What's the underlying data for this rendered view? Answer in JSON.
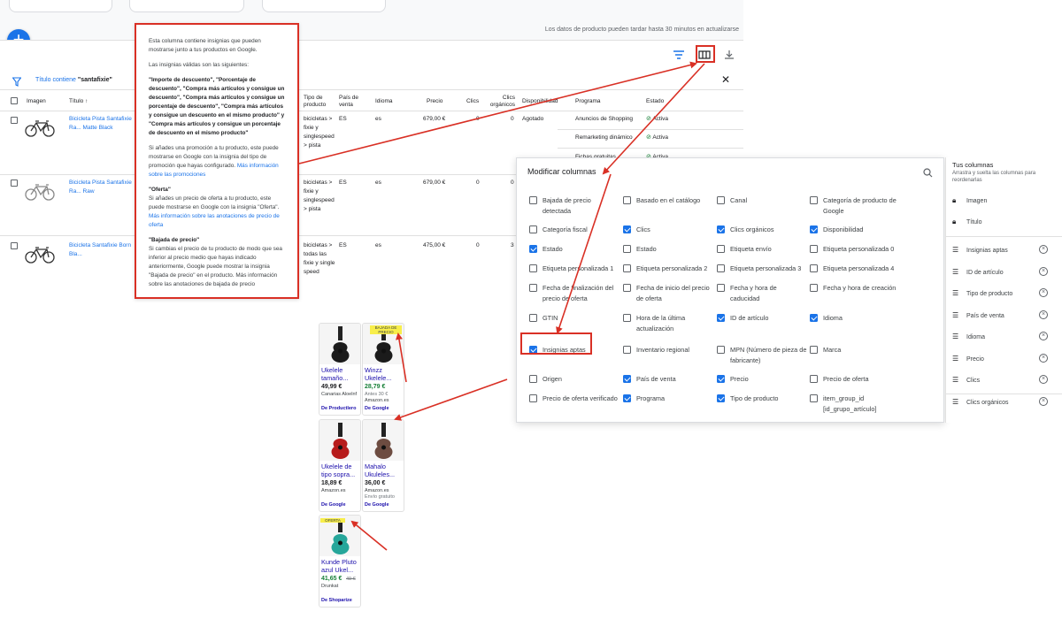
{
  "header": {
    "notice": "Los datos de producto pueden tardar hasta 30 minutos en actualizarse",
    "add_button": "+"
  },
  "filter": {
    "prefix": "Título contiene ",
    "value": "\"santafixie\""
  },
  "table": {
    "headers": {
      "imagen": "Imagen",
      "titulo": "Título",
      "tipo": "Tipo de producto",
      "pais": "País de venta",
      "idioma": "Idioma",
      "precio": "Precio",
      "clics": "Clics",
      "clics_org": "Clics orgánicos",
      "disp": "Disponibilidad",
      "programa": "Programa",
      "estado": "Estado"
    },
    "rows": [
      {
        "title": "Bicicleta Pista Santafixie Ra... Matte Black",
        "tipo": "bicicletas > fixie y singlespeed > pista",
        "pais": "ES",
        "idioma": "es",
        "precio": "679,00 €",
        "clics": "0",
        "clics_org": "0",
        "disp": "Agotado"
      },
      {
        "title": "Bicicleta Pista Santafixie Ra... Raw",
        "tipo": "bicicletas > fixie y singlespeed > pista",
        "pais": "ES",
        "idioma": "es",
        "precio": "679,00 €",
        "clics": "0",
        "clics_org": "0",
        "disp": ""
      },
      {
        "title": "Bicicleta Santafixie Born Bla...",
        "tipo": "bicicletas > todas las fixie y single speed",
        "pais": "ES",
        "idioma": "es",
        "precio": "475,00 €",
        "clics": "0",
        "clics_org": "3",
        "disp": ""
      }
    ],
    "programs": [
      "Anuncios de Shopping",
      "Remarketing dinámico",
      "Fichas gratuitas"
    ],
    "status": "Activa"
  },
  "tooltip": {
    "p1": "Esta columna contiene insignias que pueden mostrarse junto a tus productos en Google.",
    "p2": "Las insignias válidas son las siguientes:",
    "p3": "\"Importe de descuento\", \"Porcentaje de descuento\", \"Compra más artículos y consigue un descuento\", \"Compra más artículos y consigue un porcentaje de descuento\", \"Compra más artículos y consigue un descuento en el mismo producto\" y \"Compra más artículos y consigue un porcentaje de descuento en el mismo producto\"",
    "p4": "Si añades una promoción a tu producto, este puede mostrarse en Google con la insignia del tipo de promoción que hayas configurado. ",
    "p4_link": "Más información sobre las promociones",
    "h5": "\"Oferta\"",
    "p5": "Si añades un precio de oferta a tu producto, este puede mostrarse en Google con la insignia \"Oferta\". ",
    "p5_link": "Más información sobre las anotaciones de precio de oferta",
    "h6": "\"Bajada de precio\"",
    "p6": "Si cambias el precio de tu producto de modo que sea inferior al precio medio que hayas indicado anteriormente, Google puede mostrar la insignia \"Bajada de precio\" en el producto. Más información sobre las anotaciones de bajada de precio"
  },
  "modal": {
    "title": "Modificar columnas",
    "options": [
      {
        "label": "Bajada de precio detectada",
        "checked": false
      },
      {
        "label": "Basado en el catálogo",
        "checked": false
      },
      {
        "label": "Canal",
        "checked": false
      },
      {
        "label": "Categoría de producto de Google",
        "checked": false
      },
      {
        "label": "Categoría fiscal",
        "checked": false
      },
      {
        "label": "Clics",
        "checked": true
      },
      {
        "label": "Clics orgánicos",
        "checked": true
      },
      {
        "label": "Disponibilidad",
        "checked": true
      },
      {
        "label": "Estado",
        "checked": true
      },
      {
        "label": "Estado",
        "checked": false
      },
      {
        "label": "Etiqueta envío",
        "checked": false
      },
      {
        "label": "Etiqueta personalizada 0",
        "checked": false
      },
      {
        "label": "Etiqueta personalizada 1",
        "checked": false
      },
      {
        "label": "Etiqueta personalizada 2",
        "checked": false
      },
      {
        "label": "Etiqueta personalizada 3",
        "checked": false
      },
      {
        "label": "Etiqueta personalizada 4",
        "checked": false
      },
      {
        "label": "Fecha de finalización del precio de oferta",
        "checked": false
      },
      {
        "label": "Fecha de inicio del precio de oferta",
        "checked": false
      },
      {
        "label": "Fecha y hora de caducidad",
        "checked": false
      },
      {
        "label": "Fecha y hora de creación",
        "checked": false
      },
      {
        "label": "GTIN",
        "checked": false
      },
      {
        "label": "Hora de la última actualización",
        "checked": false
      },
      {
        "label": "ID de artículo",
        "checked": true
      },
      {
        "label": "Idioma",
        "checked": true
      },
      {
        "label": "Insignias aptas",
        "checked": true
      },
      {
        "label": "Inventario regional",
        "checked": false
      },
      {
        "label": "MPN (Número de pieza de fabricante)",
        "checked": false
      },
      {
        "label": "Marca",
        "checked": false
      },
      {
        "label": "Origen",
        "checked": false
      },
      {
        "label": "País de venta",
        "checked": true
      },
      {
        "label": "Precio",
        "checked": true
      },
      {
        "label": "Precio de oferta",
        "checked": false
      },
      {
        "label": "Precio de oferta verificado",
        "checked": false
      },
      {
        "label": "Programa",
        "checked": true
      },
      {
        "label": "Tipo de producto",
        "checked": true
      },
      {
        "label": "item_group_id [id_grupo_artículo]",
        "checked": false
      }
    ]
  },
  "your_columns": {
    "title": "Tus columnas",
    "subtitle": "Arrastra y suelta las columnas para reordenarlas",
    "locked": [
      "Imagen",
      "Título"
    ],
    "items": [
      "Insignias aptas",
      "ID de artículo",
      "Tipo de producto",
      "País de venta",
      "Idioma",
      "Precio",
      "Clics",
      "Clics orgánicos"
    ]
  },
  "products": [
    {
      "title": "Ukelele tamaño...",
      "price": "49,99 €",
      "store": "Canarias Aloelnf",
      "from": "De Productlero",
      "badge": ""
    },
    {
      "title": "Winzz Ukelele...",
      "price": "28,79 €",
      "old": "Antes 30 €",
      "store": "Amazon.es",
      "from": "De Google",
      "badge": "BAJADA DE PRECIO"
    },
    {
      "title": "Ukelele de tipo sopra...",
      "price": "18,89 €",
      "store": "Amazon.es",
      "from": "De Google",
      "badge": ""
    },
    {
      "title": "Mahalo Ukuleles...",
      "price": "36,00 €",
      "store": "Amazon.es",
      "extra": "Envío gratuito",
      "from": "De Google",
      "badge": ""
    },
    {
      "title": "Kunde Pluto azul Ukel...",
      "price": "41,65 €",
      "old": "49 €",
      "store": "Drunkat",
      "from": "De Shoparize",
      "badge": "OFERTA"
    }
  ],
  "colors": {
    "accent": "#1a73e8",
    "highlight": "#d93025",
    "ok": "#188038"
  }
}
